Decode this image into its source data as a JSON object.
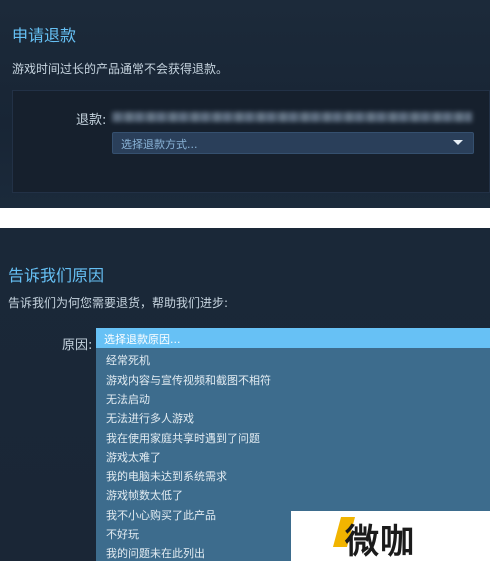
{
  "refund_panel": {
    "title": "申请退款",
    "notice": "游戏时间过长的产品通常不会获得退款。",
    "refund_label": "退款:",
    "method_placeholder": "选择退款方式..."
  },
  "reason_panel": {
    "title": "告诉我们原因",
    "prompt": "告诉我们为何您需要退货，帮助我们进步:",
    "reason_label": "原因:",
    "selected": "选择退款原因...",
    "options": [
      "经常死机",
      "游戏内容与宣传视频和截图不相符",
      "无法启动",
      "无法进行多人游戏",
      "我在使用家庭共享时遇到了问题",
      "游戏太难了",
      "我的电脑未达到系统需求",
      "游戏帧数太低了",
      "我不小心购买了此产品",
      "不好玩",
      "我的问题未在此列出"
    ]
  },
  "watermark": {
    "text": "微咖",
    "accent_color": "#f1b400"
  },
  "colors": {
    "accent": "#66c0f4",
    "selected_bg": "#67c1f5",
    "list_bg": "#3d6c8d"
  }
}
